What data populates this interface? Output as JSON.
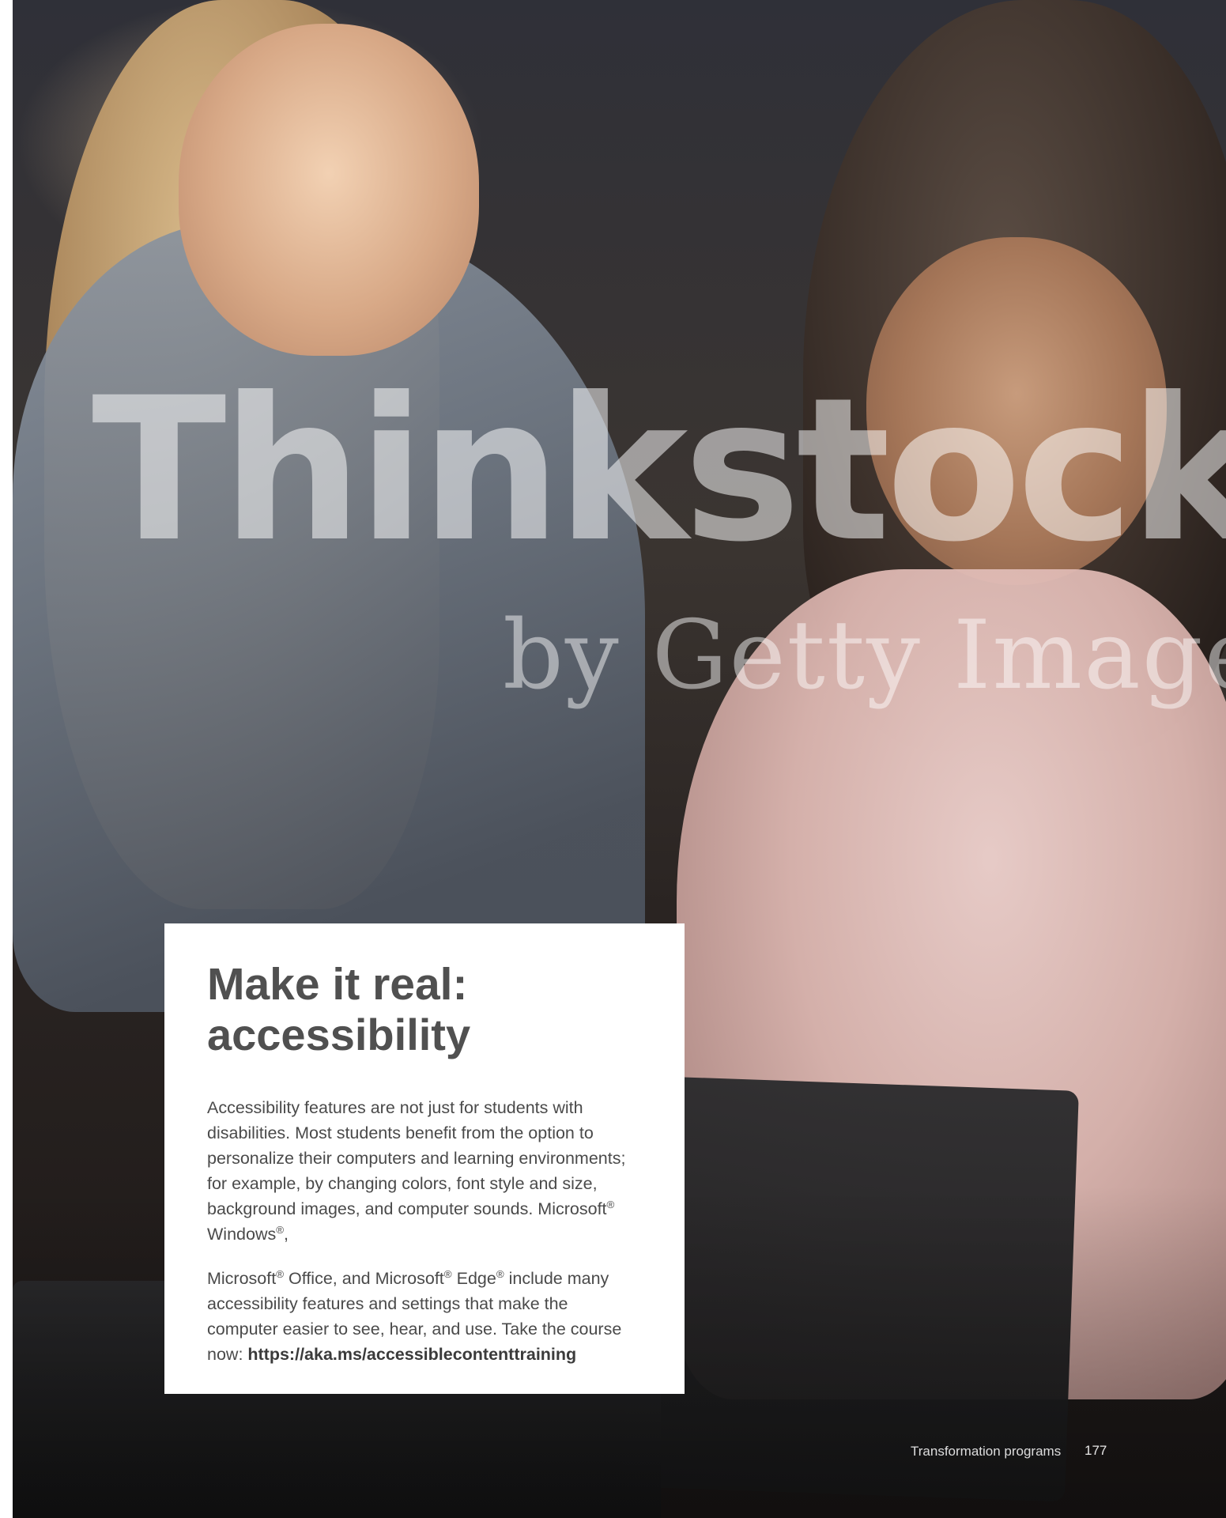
{
  "watermark": {
    "brand": "Thinkstock",
    "byline": "by Getty Images"
  },
  "card": {
    "title": "Make it real:",
    "subtitle": "accessibility",
    "para1": {
      "text_a": "Accessibility features are not just for students with disabilities. Most students benefit from the option to personalize their computers and learning environments; for example, by changing colors, font style and size, background images, and computer sounds. Microsoft",
      "reg": "®",
      "text_b": " Windows",
      "text_c": ","
    },
    "para2": {
      "text_a": "Microsoft",
      "reg": "®",
      "text_b": " Office, and Microsoft",
      "text_c": " Edge",
      "text_d": " include many accessibility features and settings that make the computer easier to see, hear, and use. Take the course now: ",
      "link": "https://aka.ms/accessiblecontenttraining"
    }
  },
  "footer": {
    "section": "Transformation programs",
    "page_number": "177"
  }
}
